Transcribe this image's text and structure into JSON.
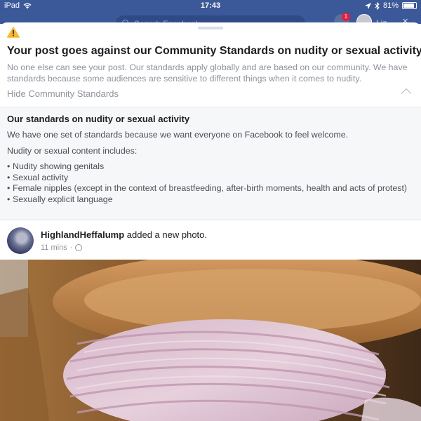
{
  "status_bar": {
    "device": "iPad",
    "time": "17:43",
    "battery": "81%"
  },
  "nav": {
    "search_placeholder": "Search Facebook",
    "notification_count": "1",
    "user_short": "Liz"
  },
  "warning": {
    "title": "Your post goes against our Community Standards on nudity or sexual activity",
    "description": "No one else can see your post. Our standards apply globally and are based on our community. We have standards because some audiences are sensitive to different things when it comes to nudity.",
    "toggle_label": "Hide Community Standards"
  },
  "standards": {
    "heading": "Our standards on nudity or sexual activity",
    "intro": "We have one set of standards because we want everyone on Facebook to feel welcome.",
    "includes_label": "Nudity or sexual content includes:",
    "items": [
      "Nudity showing genitals",
      "Sexual activity",
      "Female nipples (except in the context of breastfeeding, after-birth moments, health and acts of protest)",
      "Sexually explicit language"
    ]
  },
  "post": {
    "author": "HighlandHeffalump",
    "action": "added a new photo.",
    "time": "11 mins",
    "separator": "·"
  },
  "colors": {
    "facebook_blue": "#3b5998",
    "warning_yellow": "#f7b928",
    "muted_text": "#8d949e"
  }
}
